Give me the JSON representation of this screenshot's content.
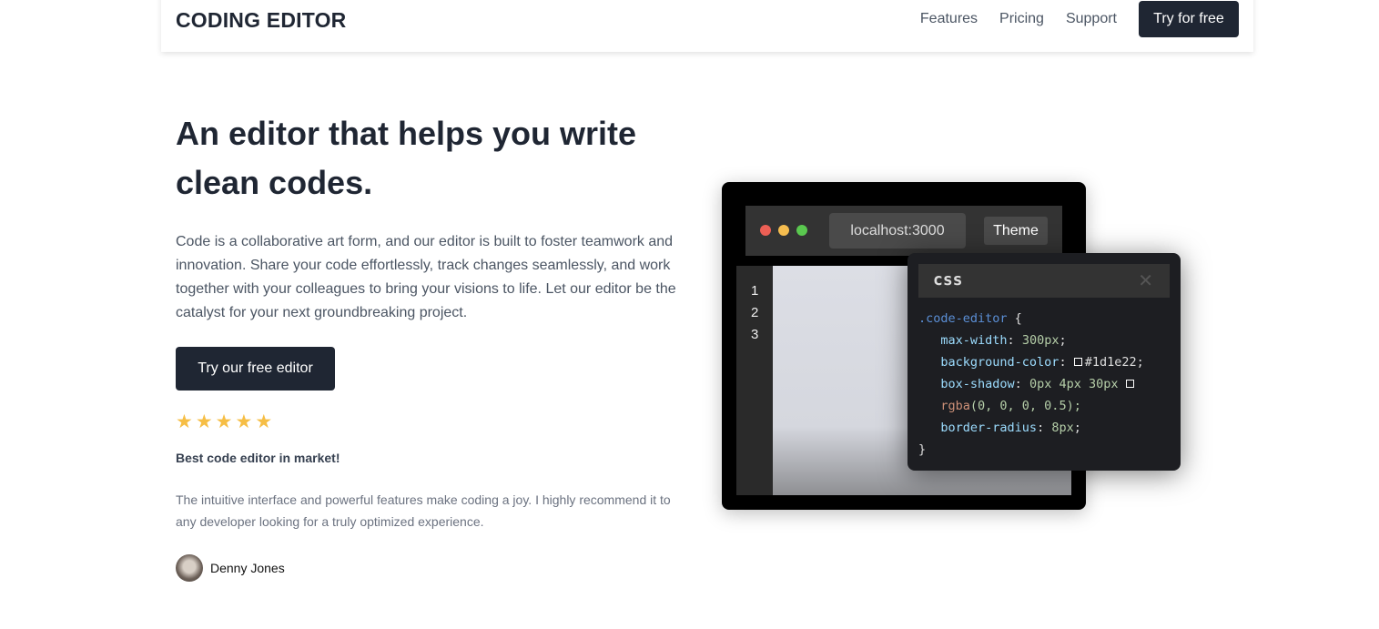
{
  "header": {
    "logo": "CODING EDITOR",
    "nav": [
      "Features",
      "Pricing",
      "Support"
    ],
    "cta": "Try for free"
  },
  "hero": {
    "title": "An editor that helps you write clean codes.",
    "description": "Code is a collaborative art form, and our editor is built to foster teamwork and innovation. Share your code effortlessly, track changes seamlessly, and work together with your colleagues to bring your visions to life. Let our editor be the catalyst for your next groundbreaking project.",
    "cta": "Try our free editor",
    "rating": 5,
    "review_title": "Best code editor in market!",
    "review_text": "The intuitive interface and powerful features make coding a joy. I highly recommend it to any developer looking for a truly optimized experience.",
    "reviewer": "Denny Jones"
  },
  "editor": {
    "address": "localhost:3000",
    "theme_button": "Theme",
    "line_numbers": [
      "1",
      "2",
      "3"
    ],
    "dot_colors": [
      "#ec5f55",
      "#f5bd4f",
      "#5ac84f"
    ],
    "popup": {
      "language": "css",
      "close": "✕",
      "selector": ".code-editor",
      "open": " {",
      "close_brace": "}",
      "lines": [
        {
          "prop": "max-width",
          "value": "300px"
        },
        {
          "prop": "background-color",
          "swatch": true,
          "value": "#1d1e22"
        },
        {
          "prop": "box-shadow",
          "value": "0px 4px 30px",
          "swatch": true
        },
        {
          "fn": "rgba",
          "args": "(0, 0, 0, 0.5);"
        },
        {
          "prop": "border-radius",
          "value": "8px"
        }
      ]
    }
  }
}
